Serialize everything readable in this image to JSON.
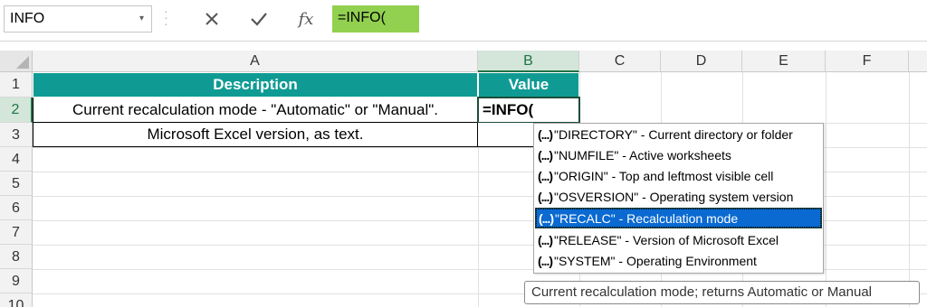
{
  "formula_bar": {
    "name_box": "INFO",
    "name_box_arrow": "▾",
    "cancel_glyph": "✕",
    "enter_glyph": "✔",
    "fx_label": "fx",
    "formula": "=INFO("
  },
  "columns": [
    "A",
    "B",
    "C",
    "D",
    "E",
    "F"
  ],
  "rows": [
    "1",
    "2",
    "3",
    "4",
    "5",
    "6",
    "7",
    "8",
    "9",
    "10"
  ],
  "sheet": {
    "header": {
      "description": "Description",
      "value": "Value"
    },
    "rows": [
      {
        "description": "Current recalculation mode - \"Automatic\" or \"Manual\".",
        "value": "=INFO("
      },
      {
        "description": "Microsoft Excel version, as text.",
        "value": ""
      }
    ]
  },
  "autocomplete": {
    "icon": "(...)",
    "items": [
      {
        "label": "\"DIRECTORY\" - Current directory or folder"
      },
      {
        "label": "\"NUMFILE\" - Active worksheets"
      },
      {
        "label": "\"ORIGIN\" - Top and leftmost visible cell"
      },
      {
        "label": "\"OSVERSION\" - Operating system version"
      },
      {
        "label": "\"RECALC\" - Recalculation mode"
      },
      {
        "label": "\"RELEASE\" - Version of Microsoft Excel"
      },
      {
        "label": "\"SYSTEM\" - Operating Environment"
      }
    ],
    "selected_index": 4
  },
  "tooltip": "Current recalculation mode; returns Automatic or Manual",
  "colors": {
    "header_fill": "#0f9b93",
    "formula_highlight": "#92d050",
    "selection_blue": "#0a6ad1",
    "excel_green": "#217346"
  }
}
